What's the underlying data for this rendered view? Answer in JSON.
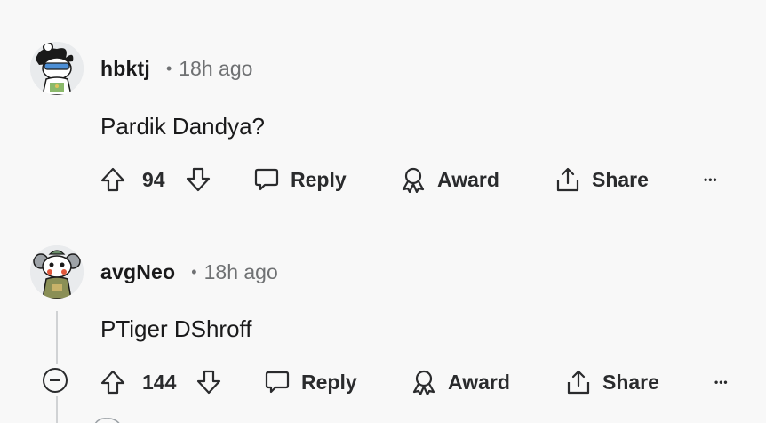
{
  "comments": [
    {
      "username": "hbktj",
      "separator": "•",
      "timestamp": "18h ago",
      "body": "Pardik Dandya?",
      "votes": "94",
      "reply_label": "Reply",
      "award_label": "Award",
      "share_label": "Share",
      "more_label": "•••"
    },
    {
      "username": "avgNeo",
      "separator": "•",
      "timestamp": "18h ago",
      "body": "PTiger DShroff",
      "votes": "144",
      "reply_label": "Reply",
      "award_label": "Award",
      "share_label": "Share",
      "more_label": "•••"
    }
  ],
  "colors": {
    "background": "#f8f8f8",
    "text_primary": "#1a1a1b",
    "text_secondary": "#6f7173",
    "thread_line": "#d0d2d4"
  }
}
